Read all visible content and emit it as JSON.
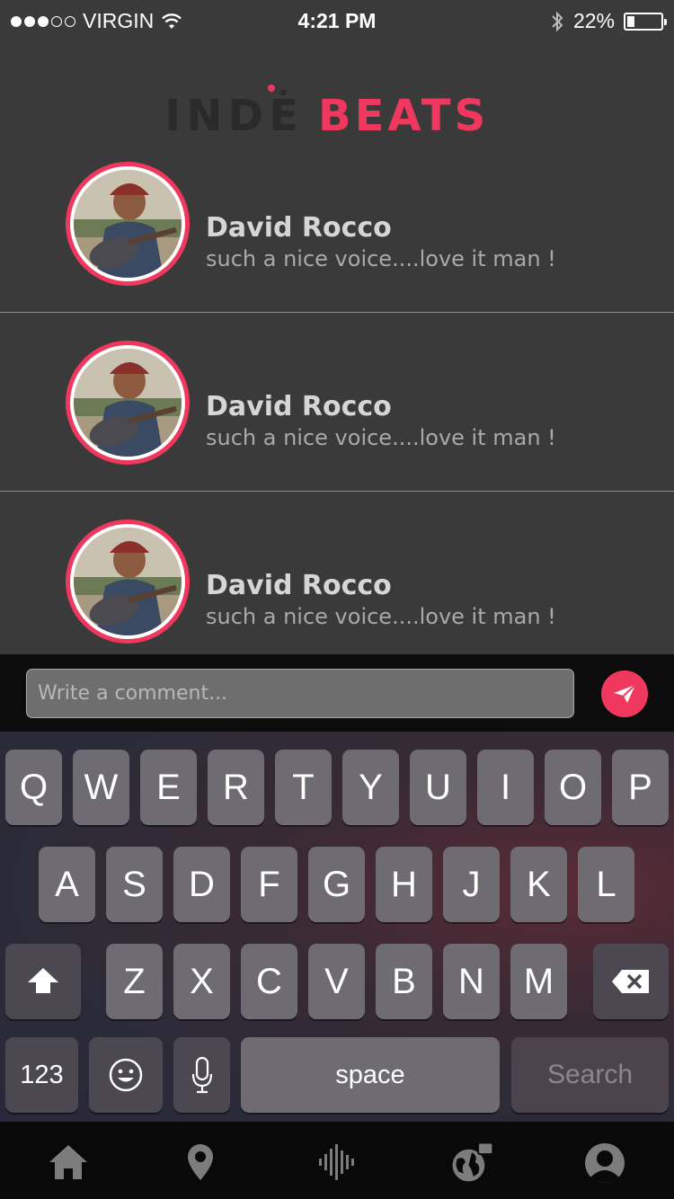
{
  "status_bar": {
    "carrier": "VIRGIN",
    "time": "4:21 PM",
    "battery_percent": "22%",
    "battery_level": 0.22,
    "signal_bars": 3,
    "signal_total": 5
  },
  "app": {
    "logo_part1": "INDĖ",
    "logo_part2": "BEATS",
    "accent_color": "#f0385e"
  },
  "comments": [
    {
      "author": "David Rocco",
      "text": "such a nice voice....love it man !"
    },
    {
      "author": "David Rocco",
      "text": "such a nice voice....love it man !"
    },
    {
      "author": "David Rocco",
      "text": "such a nice voice....love it man !"
    }
  ],
  "comment_input": {
    "placeholder": "Write a comment...",
    "value": ""
  },
  "keyboard": {
    "row1": [
      "Q",
      "W",
      "E",
      "R",
      "T",
      "Y",
      "U",
      "I",
      "O",
      "P"
    ],
    "row2": [
      "A",
      "S",
      "D",
      "F",
      "G",
      "H",
      "J",
      "K",
      "L"
    ],
    "row3": [
      "Z",
      "X",
      "C",
      "V",
      "B",
      "N",
      "M"
    ],
    "numbers_label": "123",
    "space_label": "space",
    "search_label": "Search"
  },
  "tab_bar": {
    "items": [
      "home-icon",
      "location-pin-icon",
      "audio-wave-icon",
      "globe-chat-icon",
      "profile-icon"
    ]
  }
}
